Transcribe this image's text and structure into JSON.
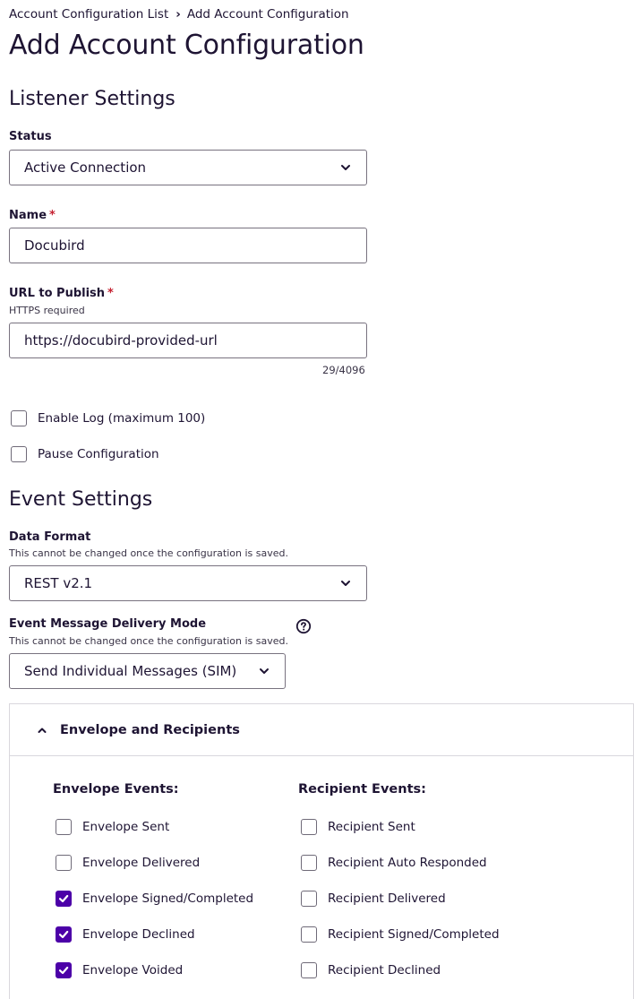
{
  "breadcrumb": {
    "parent": "Account Configuration List",
    "current": "Add Account Configuration"
  },
  "page_title": "Add Account Configuration",
  "listener": {
    "title": "Listener Settings",
    "status_label": "Status",
    "status_value": "Active Connection",
    "name_label": "Name",
    "name_value": "Docubird",
    "required_mark": "*",
    "url_label": "URL to Publish",
    "url_hint": "HTTPS required",
    "url_value": "https://docubird-provided-url",
    "url_counter": "29/4096",
    "enable_log_label": "Enable Log (maximum 100)",
    "enable_log_checked": false,
    "pause_label": "Pause Configuration",
    "pause_checked": false
  },
  "event": {
    "title": "Event Settings",
    "format_label": "Data Format",
    "format_hint": "This cannot be changed once the configuration is saved.",
    "format_value": "REST v2.1",
    "delivery_label": "Event Message Delivery Mode",
    "delivery_hint": "This cannot be changed once the configuration is saved.",
    "delivery_value": "Send Individual Messages (SIM)"
  },
  "panel": {
    "title": "Envelope and Recipients",
    "envelope_title": "Envelope Events:",
    "recipient_title": "Recipient Events:",
    "envelope_events": [
      {
        "label": "Envelope Sent",
        "checked": false
      },
      {
        "label": "Envelope Delivered",
        "checked": false
      },
      {
        "label": "Envelope Signed/Completed",
        "checked": true
      },
      {
        "label": "Envelope Declined",
        "checked": true
      },
      {
        "label": "Envelope Voided",
        "checked": true
      }
    ],
    "recipient_events": [
      {
        "label": "Recipient Sent",
        "checked": false
      },
      {
        "label": "Recipient Auto Responded",
        "checked": false
      },
      {
        "label": "Recipient Delivered",
        "checked": false
      },
      {
        "label": "Recipient Signed/Completed",
        "checked": false
      },
      {
        "label": "Recipient Declined",
        "checked": false
      }
    ]
  },
  "colors": {
    "text": "#1e1433",
    "accent": "#4c00a8",
    "required": "#c41f2f",
    "border": "#78727f"
  },
  "icons": {
    "dropdown": "chevron-down-icon",
    "collapse": "chevron-up-icon",
    "help": "question-circle-icon",
    "checked": "checkmark-icon"
  }
}
